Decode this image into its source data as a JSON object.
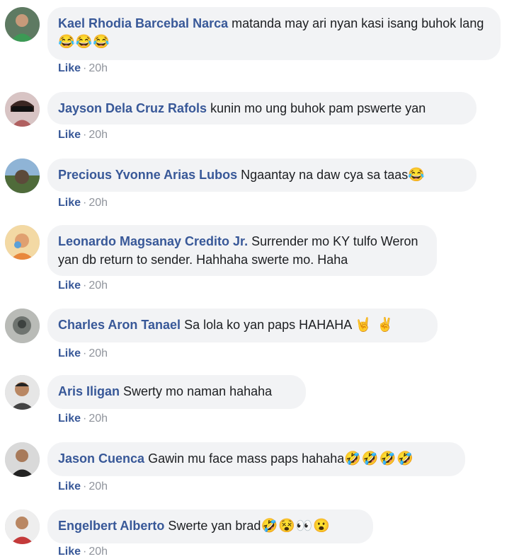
{
  "comments": [
    {
      "author": "Kael Rhodia Barcebal Narca",
      "text": "matanda may ari nyan kasi isang buhok lang",
      "emoji": "😂😂😂",
      "like": "Like",
      "time": "20h"
    },
    {
      "author": "Jayson Dela Cruz Rafols",
      "text": "kunin mo ung buhok pam pswerte yan",
      "emoji": "",
      "like": "Like",
      "time": "20h"
    },
    {
      "author": "Precious Yvonne Arias Lubos",
      "text": "Ngaantay na daw cya sa taas",
      "emoji": "😂",
      "like": "Like",
      "time": "20h"
    },
    {
      "author": "Leonardo Magsanay Credito Jr.",
      "text": "Surrender mo KY tulfo Weron yan db return to sender. Hahhaha swerte mo. Haha",
      "emoji": "",
      "like": "Like",
      "time": "20h"
    },
    {
      "author": "Charles Aron Tanael",
      "text": "Sa lola ko yan paps HAHAHA",
      "emoji": "🤘 ✌",
      "like": "Like",
      "time": "20h"
    },
    {
      "author": "Aris Iligan",
      "text": "Swerty mo naman hahaha",
      "emoji": "",
      "like": "Like",
      "time": "20h"
    },
    {
      "author": "Jason Cuenca",
      "text": "Gawin mu face mass paps hahaha",
      "emoji": "🤣🤣🤣🤣",
      "like": "Like",
      "time": "20h"
    },
    {
      "author": "Engelbert Alberto",
      "text": "Swerte yan brad",
      "emoji": "🤣😵👀😮",
      "like": "Like",
      "time": "20h"
    }
  ],
  "meta_separator": "·"
}
